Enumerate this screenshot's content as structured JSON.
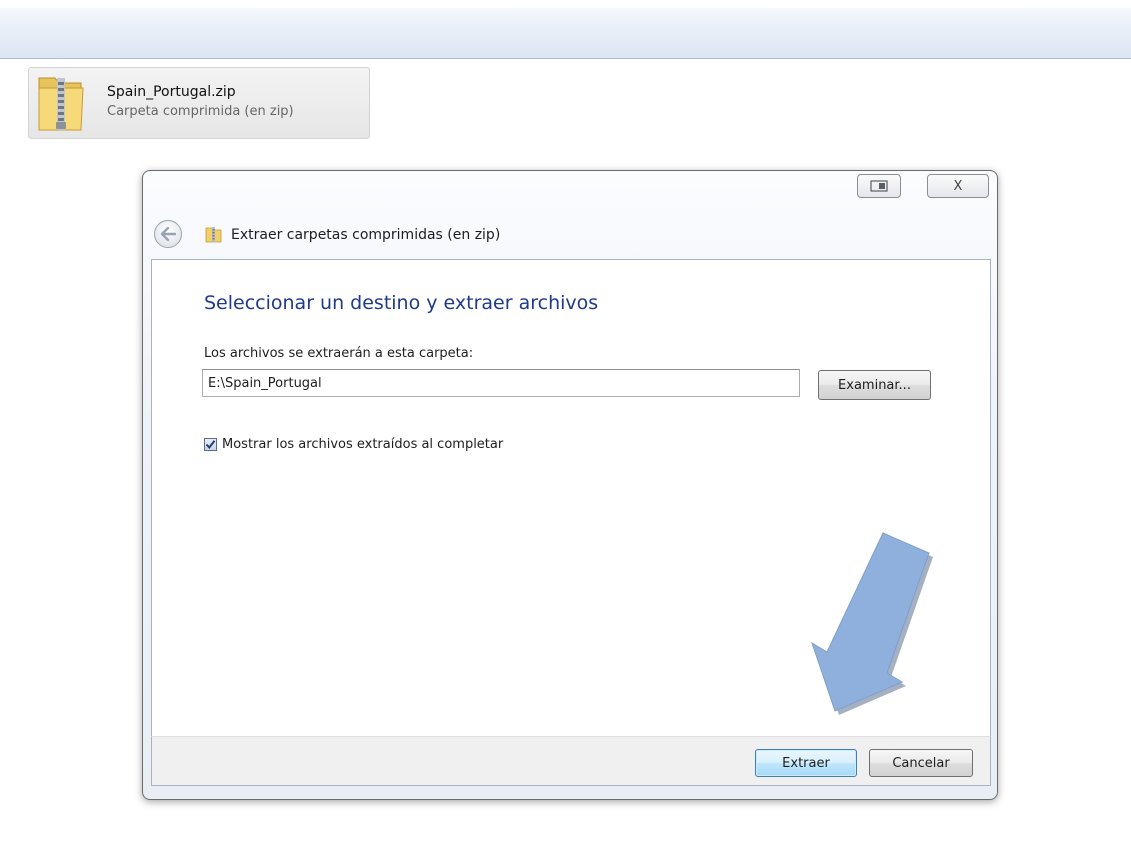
{
  "file": {
    "name": "Spain_Portugal.zip",
    "type": "Carpeta comprimida (en zip)"
  },
  "dialog": {
    "title": "Extraer carpetas comprimidas (en zip)",
    "close_glyph": "X",
    "heading": "Seleccionar un destino y extraer archivos",
    "destination_label": "Los archivos se extraerán a esta carpeta:",
    "destination_value": "E:\\Spain_Portugal",
    "browse_label": "Examinar...",
    "show_files_label": "Mostrar los archivos extraídos al completar",
    "show_files_checked": true,
    "extract_label": "Extraer",
    "cancel_label": "Cancelar"
  },
  "icons": {
    "zip_folder": "zip-folder-icon",
    "back": "back-arrow-icon",
    "restore": "restore-icon",
    "close": "close-icon",
    "callout": "callout-arrow-icon"
  },
  "colors": {
    "heading": "#1f3a8a",
    "callout_arrow": "#8fb0dd",
    "default_button_border": "#3c7fb1"
  }
}
